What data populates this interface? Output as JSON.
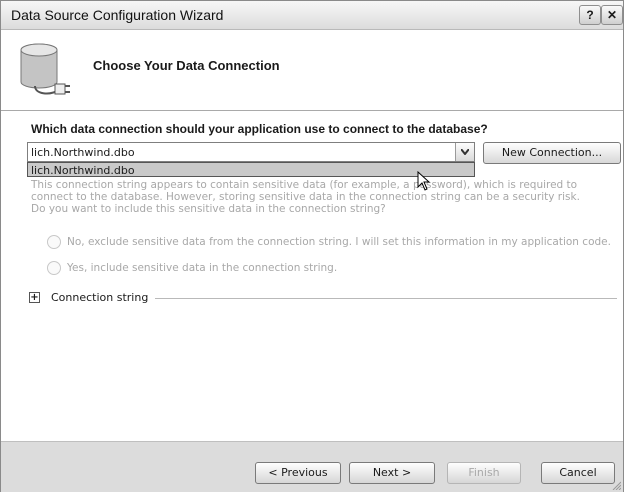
{
  "window": {
    "title": "Data Source Configuration Wizard",
    "help_glyph": "?",
    "close_glyph": "✕"
  },
  "header": {
    "heading": "Choose Your Data Connection"
  },
  "content": {
    "question": "Which data connection should your application use to connect to the database?",
    "connection_selected": "lich.Northwind.dbo",
    "dropdown_items": [
      "lich.Northwind.dbo"
    ],
    "new_connection_label": "New Connection...",
    "sensitive_warning": "This connection string appears to contain sensitive data (for example, a password), which is required to connect to the database. However, storing sensitive data in the connection string can be a security risk. Do you want to include this sensitive data in the connection string?",
    "radio_exclude_label": "No, exclude sensitive data from the connection string. I will set this information in my application code.",
    "radio_include_label": "Yes, include sensitive data in the connection string.",
    "expander_glyph": "+",
    "connection_string_label": "Connection string"
  },
  "footer": {
    "previous_label": "< Previous",
    "next_label": "Next >",
    "finish_label": "Finish",
    "cancel_label": "Cancel"
  }
}
